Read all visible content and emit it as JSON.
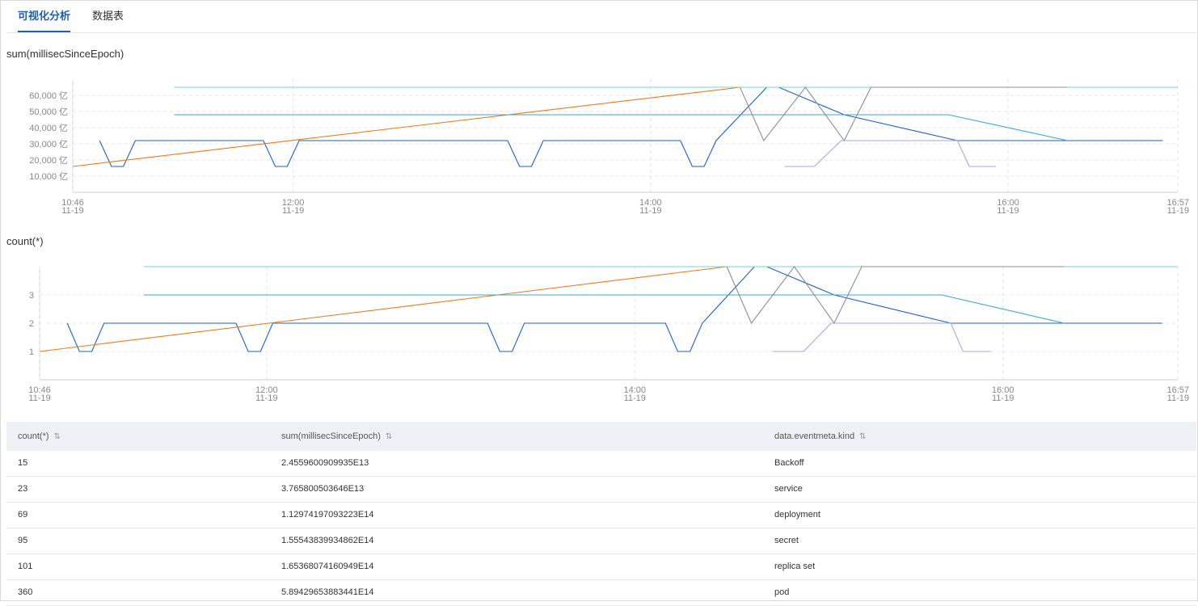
{
  "tabs": [
    {
      "label": "可视化分析",
      "active": true
    },
    {
      "label": "数据表",
      "active": false
    }
  ],
  "charts": [
    {
      "title": "sum(millisecSinceEpoch)",
      "y_ticks": [
        "60,000 亿",
        "50,000 亿",
        "40,000 亿",
        "30,000 亿",
        "20,000 亿",
        "10,000 亿"
      ],
      "x_ticks": [
        {
          "time": "10:46",
          "date": "11-19"
        },
        {
          "time": "12:00",
          "date": "11-19"
        },
        {
          "time": "14:00",
          "date": "11-19"
        },
        {
          "time": "16:00",
          "date": "11-19"
        },
        {
          "time": "16:57",
          "date": "11-19"
        }
      ]
    },
    {
      "title": "count(*)",
      "y_ticks": [
        "3",
        "2",
        "1"
      ],
      "x_ticks": [
        {
          "time": "10:46",
          "date": "11-19"
        },
        {
          "time": "12:00",
          "date": "11-19"
        },
        {
          "time": "14:00",
          "date": "11-19"
        },
        {
          "time": "16:00",
          "date": "11-19"
        },
        {
          "time": "16:57",
          "date": "11-19"
        }
      ]
    }
  ],
  "chart_data": [
    {
      "type": "line",
      "title": "sum(millisecSinceEpoch)",
      "x_start": "10:46",
      "x_end": "16:57",
      "x_axis_ticks": [
        "10:46",
        "12:00",
        "14:00",
        "16:00",
        "16:57"
      ],
      "y_unit": "亿",
      "ylim": [
        0,
        70000
      ],
      "grid": true,
      "series": [
        {
          "color": "#1a5fd6",
          "points": [
            [
              "10:55",
              32000
            ],
            [
              "10:59",
              16000
            ],
            [
              "11:03",
              16000
            ],
            [
              "11:07",
              32000
            ],
            [
              "11:50",
              32000
            ],
            [
              "11:54",
              16000
            ],
            [
              "11:58",
              16000
            ],
            [
              "12:02",
              32000
            ],
            [
              "13:12",
              32000
            ],
            [
              "13:16",
              16000
            ],
            [
              "13:20",
              16000
            ],
            [
              "13:24",
              32000
            ],
            [
              "14:10",
              32000
            ],
            [
              "14:14",
              16000
            ],
            [
              "14:18",
              16000
            ],
            [
              "14:22",
              32000
            ],
            [
              "14:39",
              65000
            ],
            [
              "14:43",
              65000
            ],
            [
              "15:05",
              48000
            ],
            [
              "15:43",
              32000
            ],
            [
              "16:52",
              32000
            ]
          ]
        },
        {
          "color": "#f0791a",
          "points": [
            [
              "10:46",
              16000
            ],
            [
              "14:30",
              65000
            ]
          ]
        },
        {
          "color": "#3aa8d8",
          "points": [
            [
              "11:20",
              48000
            ],
            [
              "15:40",
              48000
            ],
            [
              "16:20",
              32000
            ]
          ]
        },
        {
          "color": "#70d8c8",
          "points": [
            [
              "11:20",
              65000
            ],
            [
              "16:57",
              65000
            ]
          ]
        },
        {
          "color": "#8a8f99",
          "points": [
            [
              "14:30",
              65000
            ],
            [
              "14:38",
              32000
            ],
            [
              "14:52",
              65000
            ],
            [
              "15:05",
              32000
            ],
            [
              "15:14",
              65000
            ],
            [
              "16:20",
              65000
            ]
          ]
        },
        {
          "color": "#a8a6e8",
          "points": [
            [
              "14:45",
              16000
            ],
            [
              "14:55",
              16000
            ],
            [
              "15:04",
              32000
            ],
            [
              "15:43",
              32000
            ],
            [
              "15:47",
              16000
            ],
            [
              "15:56",
              16000
            ]
          ]
        }
      ]
    },
    {
      "type": "line",
      "title": "count(*)",
      "x_start": "10:46",
      "x_end": "16:57",
      "x_axis_ticks": [
        "10:46",
        "12:00",
        "14:00",
        "16:00",
        "16:57"
      ],
      "ylim": [
        0,
        4
      ],
      "grid": true,
      "series": [
        {
          "color": "#1a5fd6",
          "points": [
            [
              "10:55",
              2
            ],
            [
              "10:59",
              1
            ],
            [
              "11:03",
              1
            ],
            [
              "11:07",
              2
            ],
            [
              "11:50",
              2
            ],
            [
              "11:54",
              1
            ],
            [
              "11:58",
              1
            ],
            [
              "12:02",
              2
            ],
            [
              "13:12",
              2
            ],
            [
              "13:16",
              1
            ],
            [
              "13:20",
              1
            ],
            [
              "13:24",
              2
            ],
            [
              "14:10",
              2
            ],
            [
              "14:14",
              1
            ],
            [
              "14:18",
              1
            ],
            [
              "14:22",
              2
            ],
            [
              "14:39",
              4
            ],
            [
              "14:43",
              4
            ],
            [
              "15:05",
              3
            ],
            [
              "15:43",
              2
            ],
            [
              "16:52",
              2
            ]
          ]
        },
        {
          "color": "#f0791a",
          "points": [
            [
              "10:46",
              1
            ],
            [
              "14:30",
              4
            ]
          ]
        },
        {
          "color": "#3aa8d8",
          "points": [
            [
              "11:20",
              3
            ],
            [
              "15:40",
              3
            ],
            [
              "16:20",
              2
            ]
          ]
        },
        {
          "color": "#70d8c8",
          "points": [
            [
              "11:20",
              4
            ],
            [
              "16:57",
              4
            ]
          ]
        },
        {
          "color": "#8a8f99",
          "points": [
            [
              "14:30",
              4
            ],
            [
              "14:38",
              2
            ],
            [
              "14:52",
              4
            ],
            [
              "15:05",
              2
            ],
            [
              "15:14",
              4
            ],
            [
              "16:20",
              4
            ]
          ]
        },
        {
          "color": "#a8a6e8",
          "points": [
            [
              "14:45",
              1
            ],
            [
              "14:55",
              1
            ],
            [
              "15:04",
              2
            ],
            [
              "15:43",
              2
            ],
            [
              "15:47",
              1
            ],
            [
              "15:56",
              1
            ]
          ]
        }
      ]
    }
  ],
  "table": {
    "columns": [
      "count(*)",
      "sum(millisecSinceEpoch)",
      "data.eventmeta.kind"
    ],
    "sort_icon": "⇅",
    "rows": [
      [
        "15",
        "2.4559600909935E13",
        "Backoff"
      ],
      [
        "23",
        "3.765800503646E13",
        "service"
      ],
      [
        "69",
        "1.12974197093223E14",
        "deployment"
      ],
      [
        "95",
        "1.55543839934862E14",
        "secret"
      ],
      [
        "101",
        "1.65368074160949E14",
        "replica set"
      ],
      [
        "360",
        "5.89429653883441E14",
        "pod"
      ]
    ]
  }
}
